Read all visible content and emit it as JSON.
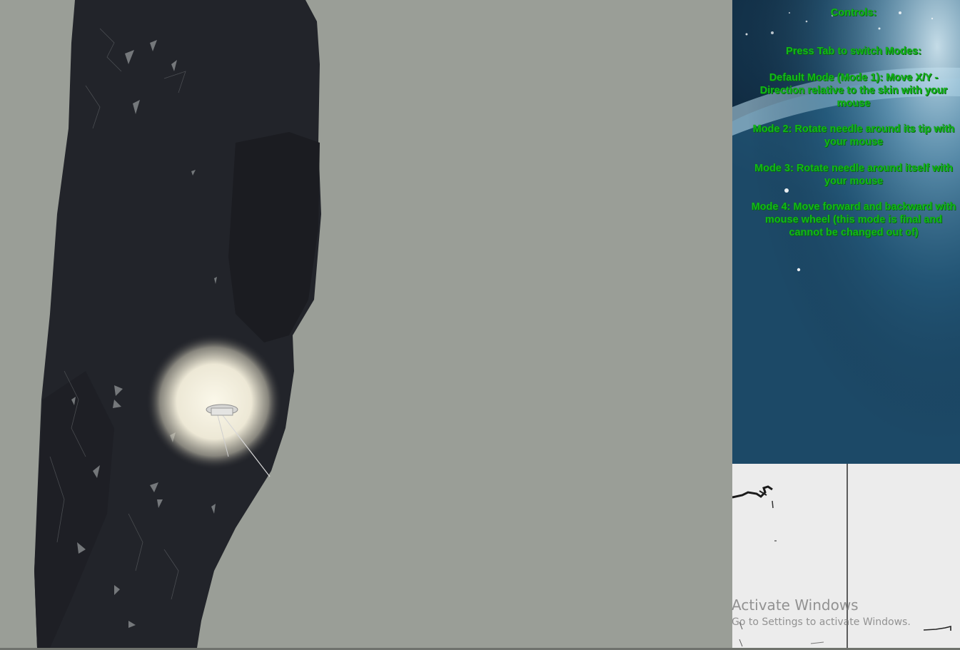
{
  "controls": {
    "title": "Controls:",
    "press_tab": "Press Tab to switch Modes:",
    "mode1": "Default Mode (Mode 1): Move X/Y - Direction relative to the skin with your mouse",
    "mode2": "Mode 2: Rotate needle around its tip with your mouse",
    "mode3": "Mode 3: Rotate needle around itself with your mouse",
    "mode4": "Mode 4: Move forward and backward with mouse wheel (this mode is final and cannot be changed out of)"
  },
  "watermark": {
    "title": "Activate Windows",
    "subtitle": "Go to Settings to activate Windows."
  },
  "colors": {
    "background": "#9a9e97",
    "arm": "#22242a",
    "controls_text": "#12b81a",
    "light_glow": "#f5f1e2"
  }
}
